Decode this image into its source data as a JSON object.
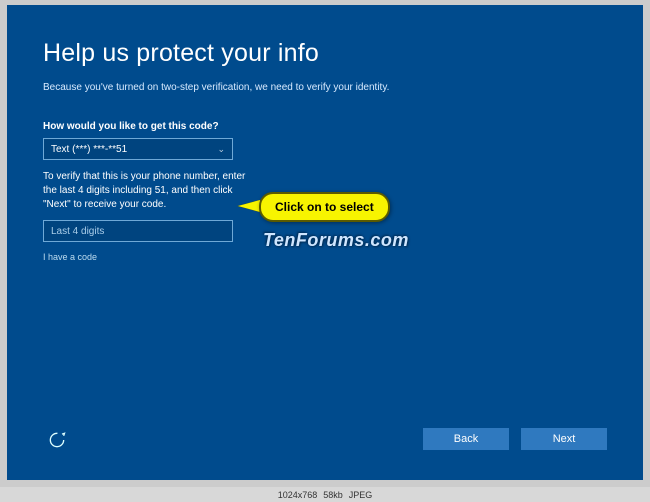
{
  "header": {
    "title": "Help us protect your info"
  },
  "body": {
    "subtext": "Because you've turned on two-step verification, we need to verify your identity.",
    "question": "How would you like to get this code?",
    "select_value": "Text (***) ***-**51",
    "verify_text": "To verify that this is your phone number, enter the last 4 digits including 51, and then click \"Next\" to receive your code.",
    "input_placeholder": "Last 4 digits",
    "havecode": "I have a code"
  },
  "callout": {
    "text": "Click on to select"
  },
  "watermark": {
    "text": "TenForums.com"
  },
  "buttons": {
    "back": "Back",
    "next": "Next"
  },
  "meta": {
    "dims": "1024x768",
    "size": "58kb",
    "fmt": "JPEG"
  }
}
